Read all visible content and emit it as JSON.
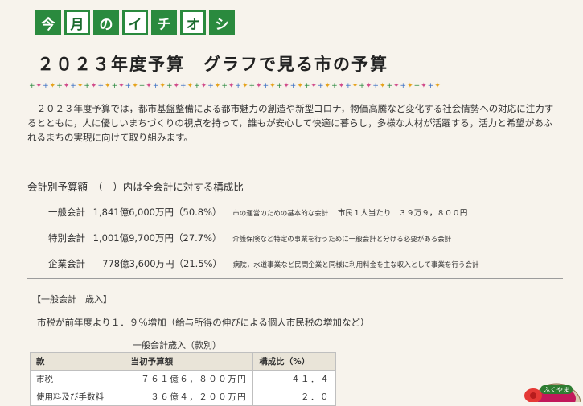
{
  "banner": {
    "chars": [
      "今",
      "月",
      "の",
      "イ",
      "チ",
      "オ",
      "シ"
    ]
  },
  "page": {
    "title": "２０２３年度予算　グラフで見る市の予算",
    "intro": "　２０２３年度予算では，都市基盤整備による都市魅力の創造や新型コロナ，物価高騰など変化する社会情勢への対応に注力するとともに，人に優しいまちづくりの視点を持って，誰もが安心して快適に暮らし，多様な人材が活躍する，活力と希望があふれるまちの実現に向けて取り組みます。"
  },
  "accounts": {
    "heading": "会計別予算額　（　）内は全会計に対する構成比",
    "rows": [
      {
        "name": "一般会計",
        "amount": "1,841億6,000万円（50.8%）",
        "desc": "市の運営のための基本的な会計",
        "extra": "市民１人当たり　３９万９，８００円"
      },
      {
        "name": "特別会計",
        "amount": "1,001億9,700万円（27.7%）",
        "desc": "介護保険など特定の事業を行うために一般会計と分ける必要がある会計",
        "extra": ""
      },
      {
        "name": "企業会計",
        "amount": "　778億3,600万円（21.5%）",
        "desc": "病院，水道事業など民間企業と同様に利用料金を主な収入として事業を行う会計",
        "extra": ""
      }
    ]
  },
  "general_revenue": {
    "heading": "【一般会計　歳入】",
    "note": "市税が前年度より１．９％増加（給与所得の伸びによる個人市民税の増加など）",
    "table_caption": "一般会計歳入（款別）",
    "columns": [
      "款",
      "当初予算額",
      "構成比（%）"
    ],
    "rows": [
      [
        "市税",
        "７６１億６，８００万円",
        "４１．４"
      ],
      [
        "使用料及び手数料",
        "３６億４，２００万円",
        "２．０"
      ]
    ]
  },
  "mascot": {
    "label": "ふくやま"
  },
  "colors": {
    "accent": "#2a8a3e",
    "background": "#f7f3ec",
    "table_header": "#e9e4d8"
  }
}
